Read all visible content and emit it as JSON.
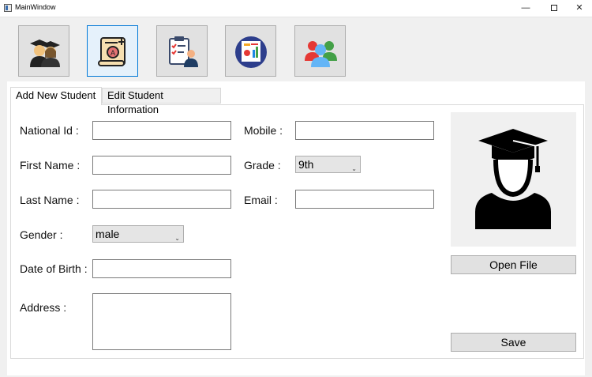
{
  "window": {
    "title": "MainWindow",
    "minimize": "—",
    "close": "✕"
  },
  "toolbar": [
    {
      "icon": "students-icon"
    },
    {
      "icon": "certificate-icon"
    },
    {
      "icon": "clipboard-teacher-icon"
    },
    {
      "icon": "report-icon"
    },
    {
      "icon": "group-users-icon"
    }
  ],
  "tabs": [
    {
      "label": "Add New Student"
    },
    {
      "label": "Edit Student Information"
    }
  ],
  "form": {
    "national_id": {
      "label": "National Id :",
      "value": ""
    },
    "first_name": {
      "label": "First Name :",
      "value": ""
    },
    "last_name": {
      "label": "Last Name :",
      "value": ""
    },
    "gender": {
      "label": "Gender :",
      "value": "male"
    },
    "dob": {
      "label": "Date of Birth :",
      "value": ""
    },
    "address": {
      "label": "Address :",
      "value": ""
    },
    "mobile": {
      "label": "Mobile :",
      "value": ""
    },
    "grade": {
      "label": "Grade :",
      "value": "9th"
    },
    "email": {
      "label": "Email :",
      "value": ""
    }
  },
  "buttons": {
    "open_file": "Open File",
    "save": "Save"
  },
  "colors": {
    "accent": "#0078d7",
    "window_bg": "#f0f0f0"
  }
}
